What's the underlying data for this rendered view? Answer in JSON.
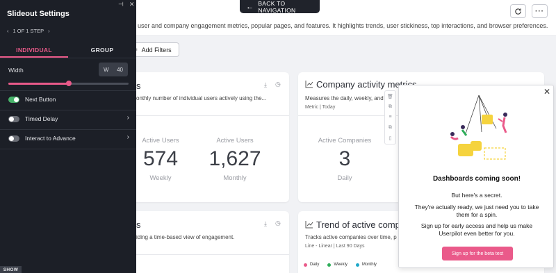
{
  "header": {
    "back_label": "BACK TO NAVIGATION",
    "description": "user and company engagement metrics, popular pages, and features. It highlights trends, user stickiness, top interactions, and browser preferences.",
    "add_filters_label": "Add Filters"
  },
  "cards": {
    "active_users": {
      "title": "s",
      "subtitle": "onthly number of individual users actively using the...",
      "metrics": [
        {
          "label": "Active Users",
          "value": "574",
          "period": "Weekly"
        },
        {
          "label": "Active Users",
          "value": "1,627",
          "period": "Monthly"
        }
      ]
    },
    "company_activity": {
      "title": "Company activity metrics",
      "subtitle": "Measures the daily, weekly, and",
      "meta": "Metric | Today",
      "metric": {
        "label": "Active Companies",
        "value": "3",
        "period": "Daily"
      }
    },
    "engagement_trend": {
      "title": "s",
      "subtitle": "iding a time-based view of engagement."
    },
    "company_trend": {
      "title": "Trend of active compa",
      "subtitle": "Tracks active companies over time, p",
      "meta": "Line - Linear | Last 90 Days",
      "legend": [
        {
          "label": "Daily",
          "color": "#ea5a8a"
        },
        {
          "label": "Weekly",
          "color": "#2fae5a"
        },
        {
          "label": "Monthly",
          "color": "#1fa8c9"
        }
      ]
    }
  },
  "panel": {
    "title": "Slideout Settings",
    "step_text": "1 OF 1 STEP",
    "tabs": [
      {
        "label": "INDIVIDUAL",
        "active": true
      },
      {
        "label": "GROUP",
        "active": false
      }
    ],
    "width_label": "Width",
    "width_prefix": "W",
    "width_value": "40",
    "slider_fraction": 0.5,
    "toggles": [
      {
        "label": "Next Button",
        "on": true,
        "has_chevron": false
      },
      {
        "label": "Timed Delay",
        "on": false,
        "has_chevron": true
      },
      {
        "label": "Interact to Advance",
        "on": false,
        "has_chevron": true
      }
    ],
    "show_label": "SHOW"
  },
  "modal": {
    "heading": "Dashboards coming soon!",
    "p1": "But here's a secret.",
    "p2": "They're actually ready, we just need you to take them for a spin.",
    "p3": "Sign up for early access and help us make Userpilot even better for you.",
    "cta": "Sign up for the beta test"
  },
  "colors": {
    "accent": "#ea5a8a",
    "toggle_on": "#47b36a",
    "panel_bg": "#1c1f27"
  }
}
